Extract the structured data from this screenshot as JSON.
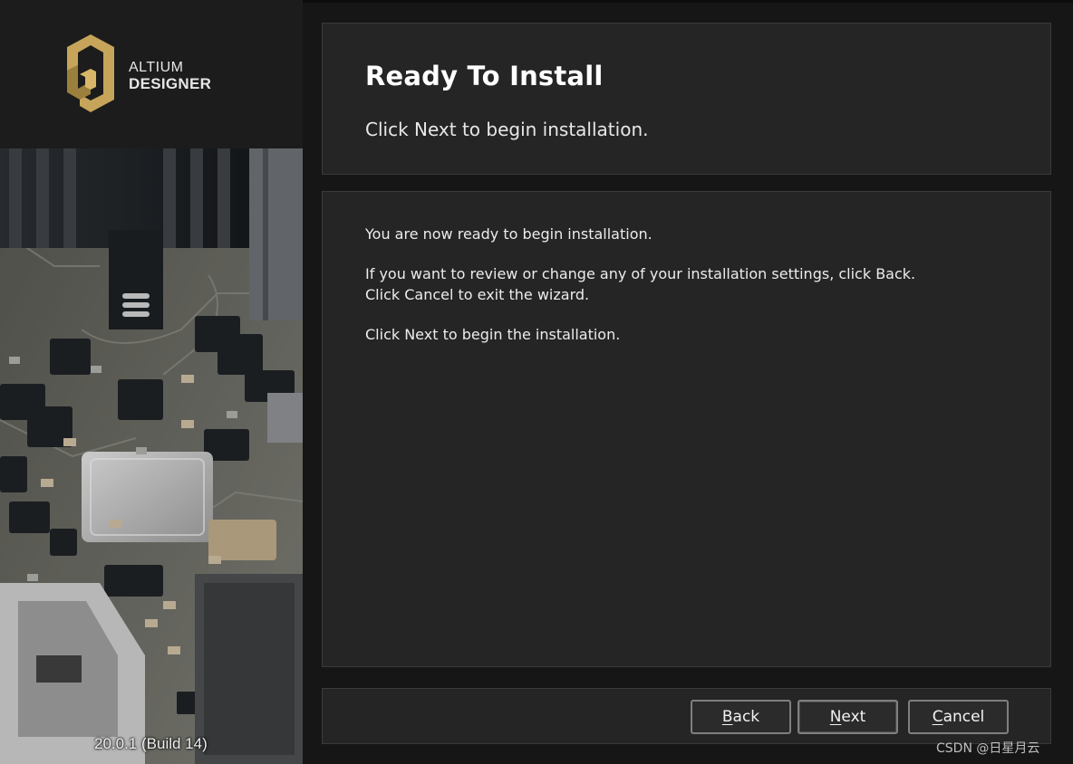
{
  "brand": {
    "line1": "ALTIUM",
    "line2": "DESIGNER",
    "gold": "#b8984f"
  },
  "version": "20.0.1 (Build 14)",
  "header": {
    "title": "Ready To Install",
    "subtitle": "Click Next to begin installation."
  },
  "content": {
    "line1": "You are now ready to begin installation.",
    "line2": "If you want to review or change any of your installation settings, click Back.",
    "line3": "Click Cancel to exit the wizard.",
    "line4": "Click Next to begin the installation."
  },
  "buttons": {
    "back": {
      "mnemonic": "B",
      "rest": "ack"
    },
    "next": {
      "mnemonic": "N",
      "rest": "ext"
    },
    "cancel": {
      "mnemonic": "C",
      "rest": "ancel"
    }
  },
  "watermark": "CSDN @日星月云",
  "colors": {
    "panel": "#252525",
    "background": "#161616",
    "button_border": "#7f7f7f"
  }
}
